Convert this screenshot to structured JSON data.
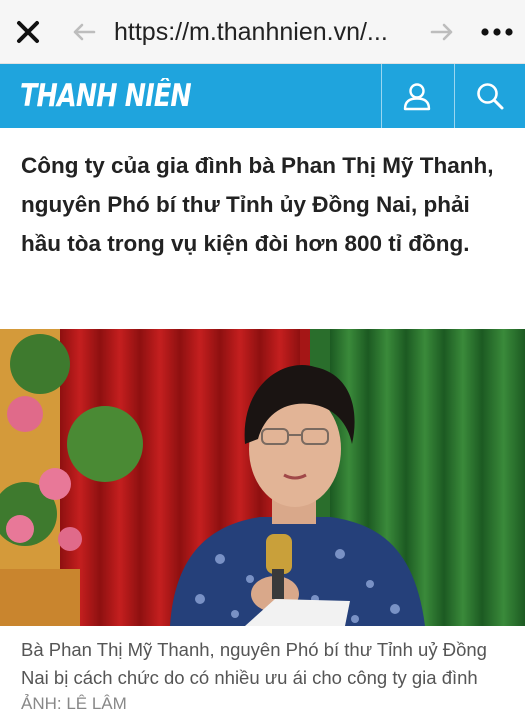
{
  "browser": {
    "url": "https://m.thanhnien.vn/...",
    "close_icon": "close-icon",
    "back_icon": "arrow-left-icon",
    "forward_icon": "arrow-right-icon",
    "more_icon": "more-dots-icon"
  },
  "site": {
    "logo_text": "THANH NIÊN",
    "brand_color": "#1fa4dd",
    "user_icon": "user-icon",
    "search_icon": "search-icon"
  },
  "article": {
    "headline": "Công ty của gia đình bà Phan Thị Mỹ Thanh, nguyên Phó bí thư Tỉnh ủy Đồng Nai, phải hầu tòa trong vụ kiện đòi hơn 800 tỉ đồng.",
    "caption": "Bà Phan Thị Mỹ Thanh, nguyên Phó bí thư Tỉnh uỷ Đồng Nai bị cách chức do có nhiều ưu ái cho công ty gia đình",
    "photo_credit": "ẢNH: LÊ LÂM"
  }
}
